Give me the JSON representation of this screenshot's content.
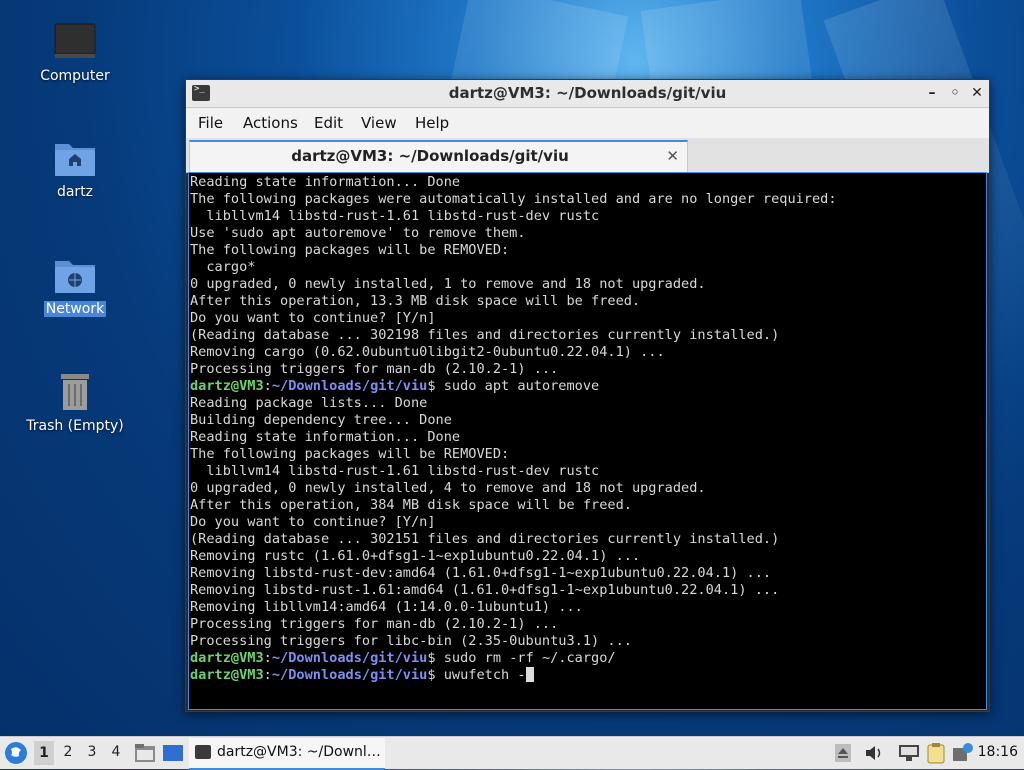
{
  "desktop": {
    "icons": [
      {
        "label": "Computer"
      },
      {
        "label": "dartz"
      },
      {
        "label": "Network"
      },
      {
        "label": "Trash (Empty)"
      }
    ]
  },
  "window": {
    "title": "dartz@VM3: ~/Downloads/git/viu",
    "controls": {
      "minimize": "–",
      "maximize": "◦",
      "restore": "⤡",
      "close": "✕"
    },
    "menu": [
      "File",
      "Actions",
      "Edit",
      "View",
      "Help"
    ],
    "tab": {
      "label": "dartz@VM3: ~/Downloads/git/viu",
      "close": "✕"
    }
  },
  "terminal": {
    "prompt": {
      "user": "dartz@VM3",
      "sep": ":",
      "path": "~/Downloads/git/viu",
      "symbol": "$"
    },
    "lines": [
      {
        "type": "out",
        "text": "Reading state information... Done"
      },
      {
        "type": "out",
        "text": "The following packages were automatically installed and are no longer required:"
      },
      {
        "type": "out",
        "text": "  libllvm14 libstd-rust-1.61 libstd-rust-dev rustc"
      },
      {
        "type": "out",
        "text": "Use 'sudo apt autoremove' to remove them."
      },
      {
        "type": "out",
        "text": "The following packages will be REMOVED:"
      },
      {
        "type": "out",
        "text": "  cargo*"
      },
      {
        "type": "out",
        "text": "0 upgraded, 0 newly installed, 1 to remove and 18 not upgraded."
      },
      {
        "type": "out",
        "text": "After this operation, 13.3 MB disk space will be freed."
      },
      {
        "type": "out",
        "text": "Do you want to continue? [Y/n]"
      },
      {
        "type": "out",
        "text": "(Reading database ... 302198 files and directories currently installed.)"
      },
      {
        "type": "out",
        "text": "Removing cargo (0.62.0ubuntu0libgit2-0ubuntu0.22.04.1) ..."
      },
      {
        "type": "out",
        "text": "Processing triggers for man-db (2.10.2-1) ..."
      },
      {
        "type": "prompt",
        "cmd": " sudo apt autoremove"
      },
      {
        "type": "out",
        "text": "Reading package lists... Done"
      },
      {
        "type": "out",
        "text": "Building dependency tree... Done"
      },
      {
        "type": "out",
        "text": "Reading state information... Done"
      },
      {
        "type": "out",
        "text": "The following packages will be REMOVED:"
      },
      {
        "type": "out",
        "text": "  libllvm14 libstd-rust-1.61 libstd-rust-dev rustc"
      },
      {
        "type": "out",
        "text": "0 upgraded, 0 newly installed, 4 to remove and 18 not upgraded."
      },
      {
        "type": "out",
        "text": "After this operation, 384 MB disk space will be freed."
      },
      {
        "type": "out",
        "text": "Do you want to continue? [Y/n]"
      },
      {
        "type": "out",
        "text": "(Reading database ... 302151 files and directories currently installed.)"
      },
      {
        "type": "out",
        "text": "Removing rustc (1.61.0+dfsg1-1~exp1ubuntu0.22.04.1) ..."
      },
      {
        "type": "out",
        "text": "Removing libstd-rust-dev:amd64 (1.61.0+dfsg1-1~exp1ubuntu0.22.04.1) ..."
      },
      {
        "type": "out",
        "text": "Removing libstd-rust-1.61:amd64 (1.61.0+dfsg1-1~exp1ubuntu0.22.04.1) ..."
      },
      {
        "type": "out",
        "text": "Removing libllvm14:amd64 (1:14.0.0-1ubuntu1) ..."
      },
      {
        "type": "out",
        "text": "Processing triggers for man-db (2.10.2-1) ..."
      },
      {
        "type": "out",
        "text": "Processing triggers for libc-bin (2.35-0ubuntu3.1) ..."
      },
      {
        "type": "prompt",
        "cmd": " sudo rm -rf ~/.cargo/"
      },
      {
        "type": "prompt",
        "cmd": " uwufetch -",
        "cursor": true
      }
    ]
  },
  "taskbar": {
    "workspaces": [
      "1",
      "2",
      "3",
      "4"
    ],
    "active_workspace": "1",
    "task_label": "dartz@VM3: ~/Downl…",
    "clock": "18:16"
  },
  "colors": {
    "prompt_user": "#6dd26d",
    "prompt_path": "#7d8ff0",
    "accent": "#3c8ce0",
    "terminal_bg": "#000000"
  }
}
